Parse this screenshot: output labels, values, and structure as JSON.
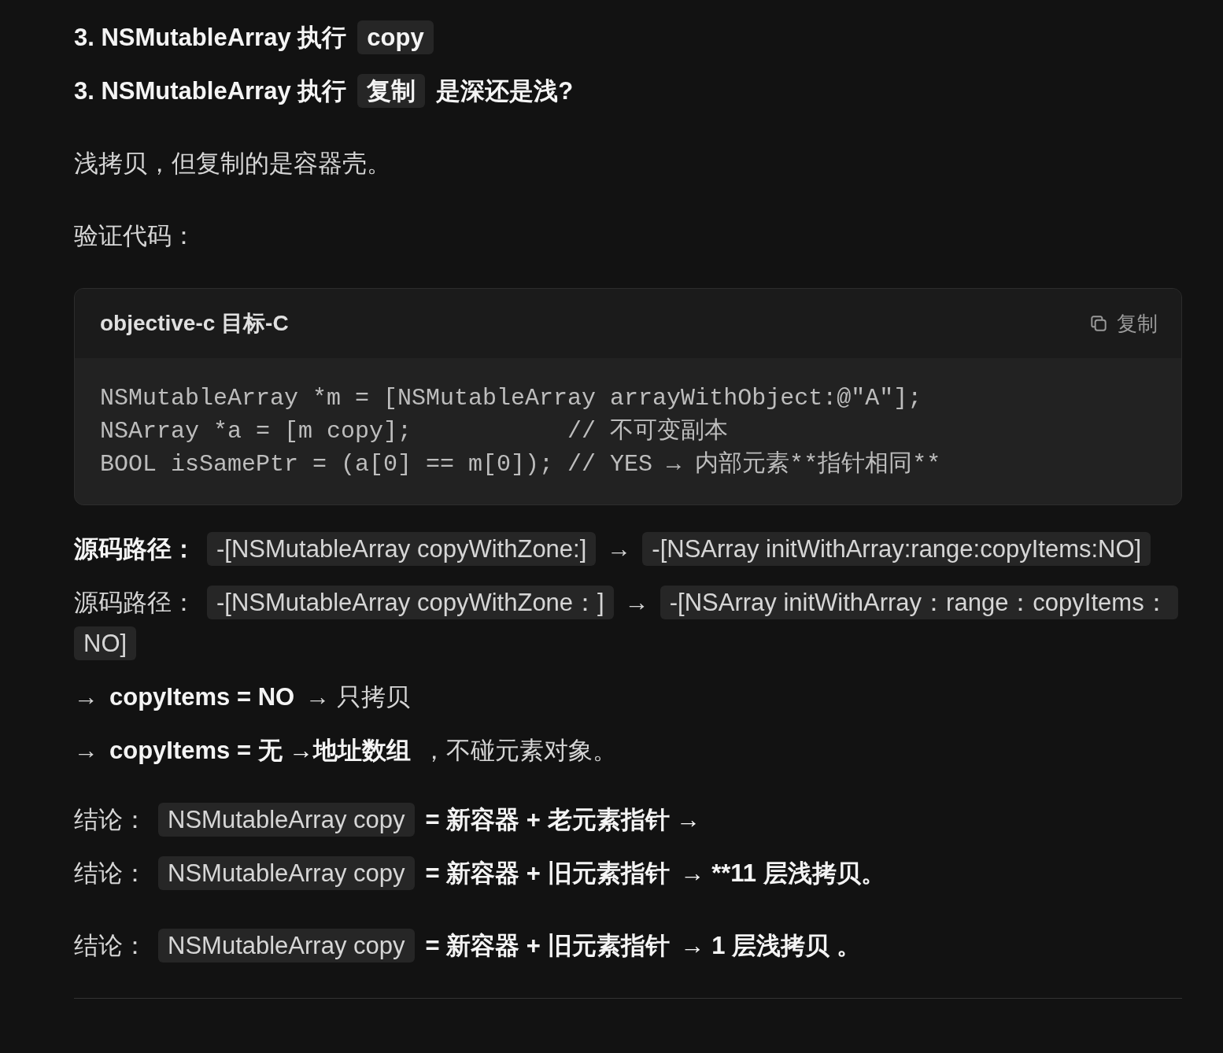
{
  "blocks_top": [
    {
      "kind": "heading",
      "segments": [
        {
          "kind": "text",
          "text": "3. NSMutableArray 执行",
          "bold": true
        },
        {
          "kind": "code",
          "text": "copy",
          "bold": true
        }
      ]
    },
    {
      "kind": "heading",
      "segments": [
        {
          "kind": "text",
          "text": "3. NSMutableArray 执行",
          "bold": true
        },
        {
          "kind": "code",
          "text": "复制",
          "bold": true
        },
        {
          "kind": "text",
          "text": "是深还是浅?",
          "bold": true
        }
      ]
    },
    {
      "kind": "spaced",
      "segments": [
        {
          "kind": "text",
          "text": "浅拷贝，但复制的是容器壳。",
          "bold": false
        }
      ]
    },
    {
      "kind": "spaced",
      "segments": [
        {
          "kind": "text",
          "text": "验证代码：",
          "bold": false
        }
      ]
    }
  ],
  "code_block": {
    "language": "objective-c 目标-C",
    "copy_label": "复制",
    "lines": [
      "NSMutableArray *m = [NSMutableArray arrayWithObject:@\"A\"];",
      "NSArray *a = [m copy];           // 不可变副本",
      "BOOL isSamePtr = (a[0] == m[0]); // YES → 内部元素**指针相同**"
    ]
  },
  "blocks_bottom": [
    {
      "kind": "text",
      "segments": [
        {
          "kind": "text",
          "text": "源码路径：",
          "bold": true
        },
        {
          "kind": "code",
          "text": "-[NSMutableArray copyWithZone:]",
          "bold": false
        },
        {
          "kind": "text",
          "text": "→",
          "bold": false
        },
        {
          "kind": "code",
          "text": "-[NSArray initWithArray:range:copyItems:NO]",
          "bold": false
        }
      ]
    },
    {
      "kind": "text",
      "segments": [
        {
          "kind": "text",
          "text": "源码路径：",
          "bold": false
        },
        {
          "kind": "code",
          "text": "-[NSMutableArray copyWithZone：]",
          "bold": false
        },
        {
          "kind": "text",
          "text": "→",
          "bold": false
        },
        {
          "kind": "code",
          "text": "-[NSArray initWithArray：range：copyItems：NO]",
          "bold": false
        }
      ]
    },
    {
      "kind": "text",
      "segments": [
        {
          "kind": "text",
          "text": "→",
          "bold": false
        },
        {
          "kind": "text",
          "text": "copyItems = NO",
          "bold": true
        },
        {
          "kind": "text",
          "text": "→ 只拷贝",
          "bold": false
        }
      ]
    },
    {
      "kind": "text",
      "segments": [
        {
          "kind": "text",
          "text": "→",
          "bold": false
        },
        {
          "kind": "text",
          "text": "copyItems = 无 →地址数组",
          "bold": true
        },
        {
          "kind": "text",
          "text": "，不碰元素对象。",
          "bold": false
        }
      ]
    },
    {
      "kind": "gap",
      "segments": [
        {
          "kind": "text",
          "text": "结论：",
          "bold": false
        },
        {
          "kind": "code",
          "text": "NSMutableArray copy",
          "bold": false
        },
        {
          "kind": "text",
          "text": "= 新容器 + 老元素指针 →",
          "bold": true
        }
      ]
    },
    {
      "kind": "text",
      "segments": [
        {
          "kind": "text",
          "text": "结论：",
          "bold": false
        },
        {
          "kind": "code",
          "text": "NSMutableArray copy",
          "bold": false
        },
        {
          "kind": "text",
          "text": "= 新容器 + 旧元素指针",
          "bold": true
        },
        {
          "kind": "text",
          "text": "→ **11 层浅拷贝。",
          "bold": true
        }
      ]
    },
    {
      "kind": "spaced",
      "segments": [
        {
          "kind": "text",
          "text": "结论：",
          "bold": false
        },
        {
          "kind": "code",
          "text": "NSMutableArray copy",
          "bold": false
        },
        {
          "kind": "text",
          "text": "= 新容器 + 旧元素指针",
          "bold": true
        },
        {
          "kind": "text",
          "text": "→ 1 层浅拷贝 。",
          "bold": true
        }
      ]
    }
  ]
}
